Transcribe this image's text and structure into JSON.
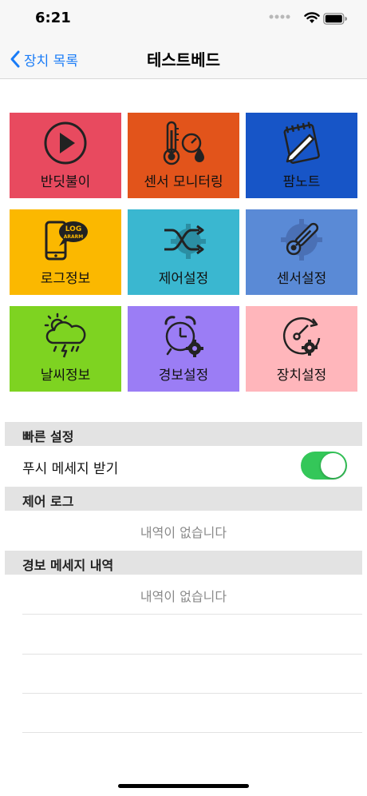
{
  "status_bar": {
    "time": "6:21"
  },
  "nav": {
    "back_label": "장치 목록",
    "title": "테스트베드"
  },
  "tiles": [
    {
      "label": "반딧불이",
      "icon": "play-circle-icon",
      "color": "#e84a5f"
    },
    {
      "label": "센서 모니터링",
      "icon": "thermometer-gauge-icon",
      "color": "#e2541b"
    },
    {
      "label": "팜노트",
      "icon": "notepad-pencil-icon",
      "color": "#1755c7"
    },
    {
      "label": "로그정보",
      "icon": "phone-log-icon",
      "log_text_1": "LOG",
      "log_text_2": "ARARM",
      "color": "#fbb800"
    },
    {
      "label": "제어설정",
      "icon": "shuffle-gear-icon",
      "color": "#3ab7d0"
    },
    {
      "label": "센서설정",
      "icon": "thermometer-gear-icon",
      "color": "#5a8ad6"
    },
    {
      "label": "날씨정보",
      "icon": "weather-storm-icon",
      "color": "#7ed321"
    },
    {
      "label": "경보설정",
      "icon": "alarm-clock-gear-icon",
      "color": "#9b7df5"
    },
    {
      "label": "장치설정",
      "icon": "dial-gear-icon",
      "color": "#ffb6bb"
    }
  ],
  "quick_settings": {
    "title": "빠른 설정",
    "push_label": "푸시 메세지 받기",
    "push_enabled": true,
    "toggle_color": "#34c759"
  },
  "control_log": {
    "title": "제어 로그",
    "empty_text": "내역이 없습니다"
  },
  "alarm_history": {
    "title": "경보 메세지 내역",
    "empty_text": "내역이 없습니다"
  }
}
